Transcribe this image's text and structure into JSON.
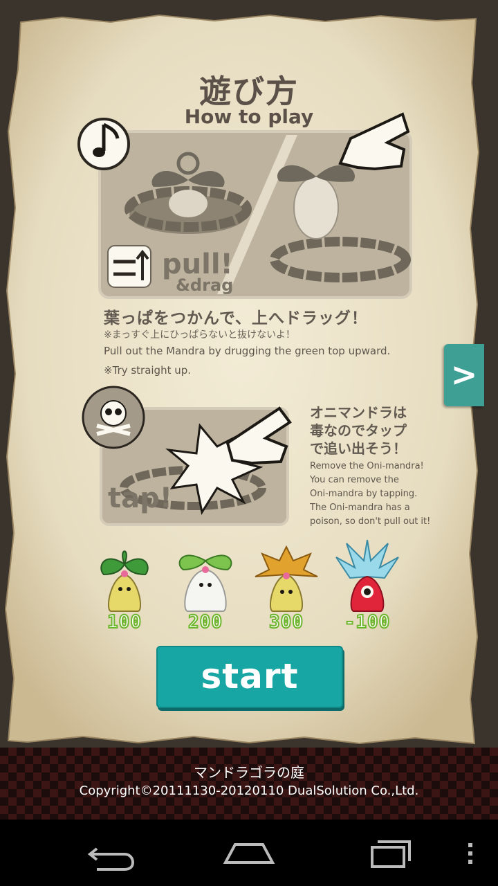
{
  "app": {
    "title": "マンドラゴラの庭"
  },
  "header": {
    "title_jp": "遊び方",
    "title_en": "How to play"
  },
  "pull_section": {
    "panel_word": "pull!",
    "panel_word2": "&drag",
    "instruction_jp": "葉っぱをつかんで、上へドラッグ！",
    "note_jp": "※まっすぐ上にひっぱらないと抜けないよ！",
    "instruction_en": "Pull out the Mandra by drugging the green top upward.",
    "note_en": "※Try straight up."
  },
  "tap_section": {
    "panel_word": "tap!",
    "text_jp": [
      "オニマンドラは",
      "毒なのでタップ",
      "で追い出そう！"
    ],
    "text_en": [
      "Remove the Oni-mandra!",
      "You can remove the",
      "Oni-mandra by tapping.",
      "The Oni-mandra has a",
      "poison, so   don't pull out it!"
    ]
  },
  "scores": [
    {
      "value": "100",
      "kind": "green-mandra"
    },
    {
      "value": "200",
      "kind": "white-mandra"
    },
    {
      "value": "300",
      "kind": "gold-mandra"
    },
    {
      "value": "-100",
      "kind": "oni-mandra"
    }
  ],
  "buttons": {
    "next": ">",
    "start": "start"
  },
  "footer": {
    "title": "マンドラゴラの庭",
    "copyright": "Copyright©20111130-20120110 DualSolution Co.,Ltd."
  },
  "navbar": {
    "icons": [
      "back-icon",
      "home-icon",
      "recents-icon",
      "menu-icon"
    ]
  },
  "colors": {
    "accent": "#17a6a3",
    "next_button": "#3e9f94",
    "parchment": "#ece3cc",
    "score_stroke": "#6db52d"
  }
}
